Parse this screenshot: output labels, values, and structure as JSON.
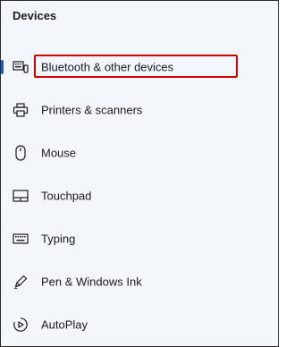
{
  "header": {
    "title": "Devices"
  },
  "nav": {
    "items": [
      {
        "label": "Bluetooth & other devices",
        "icon": "bluetooth-devices-icon",
        "selected": true
      },
      {
        "label": "Printers & scanners",
        "icon": "printer-icon",
        "selected": false
      },
      {
        "label": "Mouse",
        "icon": "mouse-icon",
        "selected": false
      },
      {
        "label": "Touchpad",
        "icon": "touchpad-icon",
        "selected": false
      },
      {
        "label": "Typing",
        "icon": "keyboard-icon",
        "selected": false
      },
      {
        "label": "Pen & Windows Ink",
        "icon": "pen-icon",
        "selected": false
      },
      {
        "label": "AutoPlay",
        "icon": "autoplay-icon",
        "selected": false
      }
    ]
  },
  "colors": {
    "accent": "#1a5fb4",
    "highlight": "#d40000",
    "background": "#f3f6fb",
    "text": "#1b1b1b"
  }
}
